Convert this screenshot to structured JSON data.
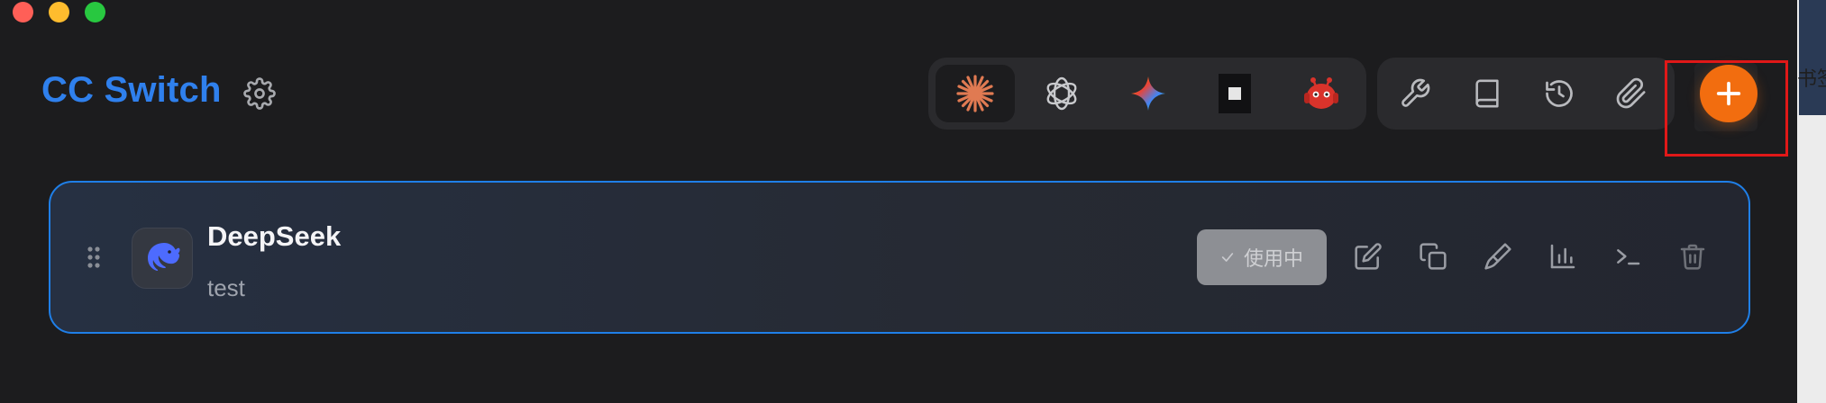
{
  "app": {
    "title": "CC Switch"
  },
  "window": {
    "controls": [
      "close",
      "minimize",
      "maximize"
    ]
  },
  "header": {
    "settings_icon": "gear-icon",
    "app_tabs": [
      {
        "name": "claude",
        "icon": "claude-sunburst-icon",
        "active": true
      },
      {
        "name": "openai",
        "icon": "openai-knot-icon",
        "active": false
      },
      {
        "name": "gemini",
        "icon": "gemini-sparkle-icon",
        "active": false
      },
      {
        "name": "terminal",
        "icon": "terminal-square-icon",
        "active": false
      },
      {
        "name": "android-bot",
        "icon": "red-bot-icon",
        "active": false
      }
    ],
    "tools": [
      {
        "name": "wrench",
        "icon": "wrench-icon"
      },
      {
        "name": "book",
        "icon": "book-icon"
      },
      {
        "name": "history",
        "icon": "history-icon"
      },
      {
        "name": "attachment",
        "icon": "paperclip-icon"
      }
    ],
    "add_icon": "plus-icon"
  },
  "providers": [
    {
      "name": "DeepSeek",
      "description": "test",
      "icon": "deepseek-whale-icon",
      "status_label": "使用中",
      "actions": [
        "edit",
        "duplicate",
        "test",
        "stats",
        "terminal",
        "delete"
      ]
    }
  ],
  "edge_text": "书签",
  "colors": {
    "accent": "#2f80ed",
    "add_button": "#f26d0f",
    "highlight": "#e01818",
    "card_border": "#1f7fe8"
  }
}
